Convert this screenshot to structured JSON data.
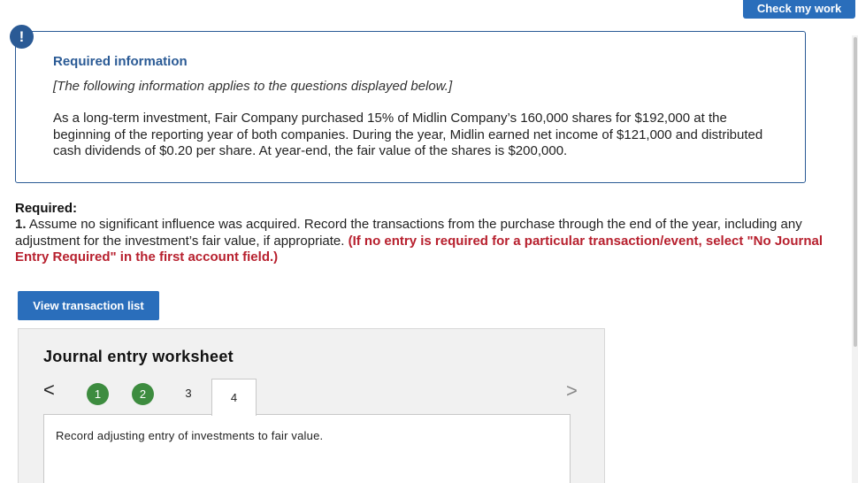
{
  "toolbar": {
    "check_my_work_label": "Check my work"
  },
  "alert": {
    "icon_glyph": "!",
    "icon_name": "exclamation-icon",
    "title": "Required information",
    "subtitle": "[The following information applies to the questions displayed below.]",
    "body": "As a long-term investment, Fair Company purchased 15% of Midlin Company’s 160,000 shares for $192,000 at the beginning of the reporting year of both companies. During the year, Midlin earned net income of $121,000 and distributed cash dividends of $0.20 per share. At year-end, the fair value of the shares is $200,000."
  },
  "required": {
    "label": "Required:",
    "number": "1.",
    "text": " Assume no significant influence was acquired. Record the transactions from the purchase through the end of the year, including any adjustment for the investment’s fair value, if appropriate. ",
    "note": "(If no entry is required for a particular transaction/event, select \"No Journal Entry Required\" in the first account field.)"
  },
  "view_transaction_list_label": "View transaction list",
  "worksheet": {
    "title": "Journal entry worksheet",
    "prev_glyph": "<",
    "next_glyph": ">",
    "steps": [
      "1",
      "2",
      "3",
      "4"
    ],
    "completed_steps": [
      "1",
      "2"
    ],
    "active_step": "4",
    "instruction": "Record adjusting entry of investments to fair value."
  },
  "colors": {
    "accent_blue": "#2a6ebb",
    "alert_blue": "#2a5a95",
    "step_done_green": "#3d8c3f",
    "note_red": "#b7202e"
  }
}
